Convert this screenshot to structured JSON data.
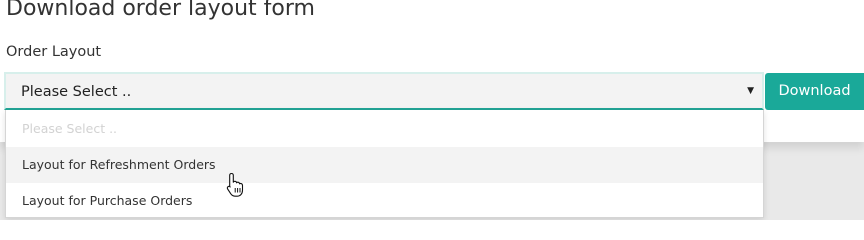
{
  "form": {
    "title": "Download order layout form",
    "field_label": "Order Layout",
    "download_label": "Download"
  },
  "select": {
    "selected_value": "Please Select ..",
    "caret": "▼",
    "options": [
      {
        "label": "Please Select ..",
        "disabled": true
      },
      {
        "label": "Layout for Refreshment Orders",
        "hovered": true
      },
      {
        "label": "Layout for Purchase Orders"
      }
    ]
  },
  "colors": {
    "accent": "#1aa999",
    "focus_border": "#22a596",
    "hover_row": "#f3f3f3"
  },
  "icons": {
    "caret": "chevron-down-icon",
    "cursor": "hand-pointer-icon"
  }
}
